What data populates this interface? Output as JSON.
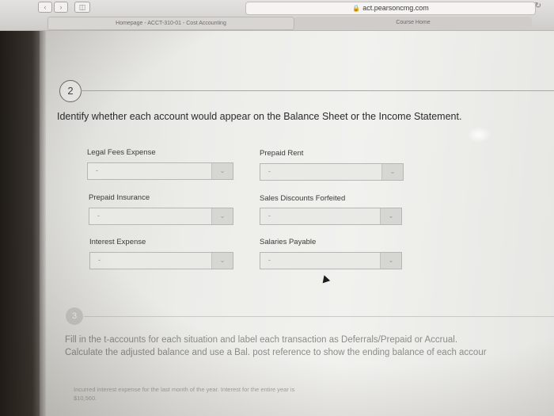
{
  "browser": {
    "url": "act.pearsoncmg.com",
    "tab_left": "Homepage - ACCT-310-01 - Cost Accounting",
    "tab_right": "Course Home"
  },
  "question2": {
    "number": "2",
    "prompt": "Identify whether each account would appear on the Balance Sheet or the Income Statement.",
    "accounts": [
      {
        "label": "Legal Fees Expense",
        "value": "-"
      },
      {
        "label": "Prepaid Rent",
        "value": "-"
      },
      {
        "label": "Prepaid Insurance",
        "value": "-"
      },
      {
        "label": "Sales Discounts Forfeited",
        "value": "-"
      },
      {
        "label": "Interest Expense",
        "value": "-"
      },
      {
        "label": "Salaries Payable",
        "value": "-"
      }
    ]
  },
  "question3": {
    "number": "3",
    "line1": "Fill in the t-accounts for each situation and label each transaction as Deferrals/Prepaid or Accrual.",
    "line2": "Calculate the adjusted balance and use a Bal. post reference to show the ending balance of each accour",
    "detail1": "Incurred interest expense for the last month of the year. Interest for the entire year is",
    "detail2": "$10,560."
  }
}
